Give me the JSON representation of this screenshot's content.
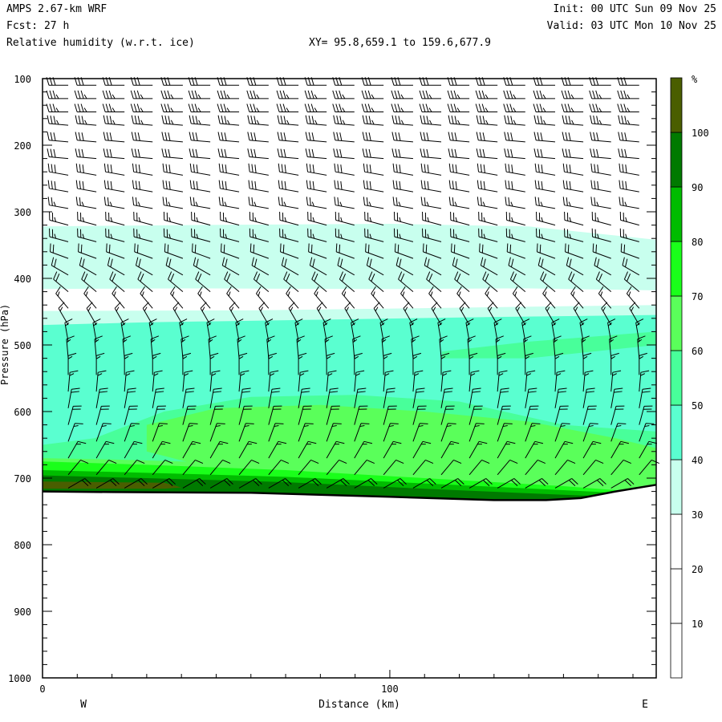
{
  "header": {
    "model": "AMPS 2.67-km WRF",
    "forecast": "Fcst:   27 h",
    "field": "Relative humidity (w.r.t. ice)",
    "xy": "XY=  95.8,659.1 to 159.6,677.9",
    "init": "Init: 00 UTC Sun 09 Nov 25",
    "valid": "Valid: 03 UTC Mon 10 Nov 25"
  },
  "chart_data": {
    "type": "heatmap",
    "title": "Relative humidity (w.r.t. ice)",
    "xlabel": "Distance (km)",
    "ylabel": "Pressure (hPa)",
    "xlim": [
      0,
      176.7
    ],
    "ylim": [
      1000,
      100
    ],
    "x_ticks": [
      "0",
      "100"
    ],
    "y_ticks": [
      "100",
      "200",
      "300",
      "400",
      "500",
      "600",
      "700",
      "800",
      "900",
      "1000"
    ],
    "left_label": "W",
    "right_label": "E",
    "colorbar": {
      "unit": "%",
      "labels": [
        "10",
        "20",
        "30",
        "40",
        "50",
        "60",
        "70",
        "80",
        "90",
        "100"
      ],
      "levels": [
        0,
        10,
        20,
        30,
        40,
        50,
        60,
        70,
        80,
        90,
        100,
        110
      ],
      "colors": [
        "#ffffff",
        "#ffffff",
        "#ffffff",
        "#c8ffee",
        "#5affd0",
        "#48ff9a",
        "#5aff5a",
        "#1aff1a",
        "#00bc00",
        "#007a00",
        "#4a5e00"
      ]
    },
    "terrain_surface": {
      "distance_km": [
        0,
        20,
        60,
        100,
        130,
        145,
        155,
        165,
        176.7
      ],
      "pressure_hPa": [
        720,
        721,
        722,
        728,
        733,
        733,
        730,
        720,
        710
      ]
    },
    "rh_regions": [
      {
        "min": 30,
        "distance_km": [
          0,
          40,
          100,
          140,
          176.7,
          176.7,
          140,
          100,
          40,
          0
        ],
        "pressure_hPa": [
          322,
          320,
          318,
          322,
          342,
          418,
          415,
          416,
          415,
          416
        ]
      },
      {
        "min": 30,
        "distance_km": [
          0,
          60,
          120,
          176.7,
          176.7,
          0
        ],
        "pressure_hPa": [
          449,
          448,
          444,
          440,
          720,
          720
        ]
      },
      {
        "min": 40,
        "distance_km": [
          0,
          30,
          80,
          130,
          176.7,
          176.7,
          0
        ],
        "pressure_hPa": [
          470,
          466,
          462,
          458,
          455,
          720,
          720
        ]
      },
      {
        "min": 50,
        "distance_km": [
          0,
          15,
          35,
          60,
          90,
          120,
          150,
          176.7,
          176.7,
          150,
          120,
          90,
          60,
          30,
          0
        ],
        "pressure_hPa": [
          650,
          640,
          600,
          578,
          575,
          585,
          620,
          630,
          700,
          705,
          710,
          712,
          700,
          690,
          690
        ]
      },
      {
        "min": 50,
        "distance_km": [
          115,
          140,
          176.7,
          176.7,
          140,
          115
        ],
        "pressure_hPa": [
          510,
          495,
          480,
          500,
          520,
          520
        ]
      },
      {
        "min": 60,
        "distance_km": [
          30,
          50,
          80,
          110,
          140,
          165,
          176.7,
          176.7,
          140,
          100,
          60,
          30
        ],
        "pressure_hPa": [
          620,
          595,
          590,
          600,
          615,
          640,
          655,
          705,
          712,
          715,
          700,
          660
        ]
      },
      {
        "min": 60,
        "distance_km": [
          0,
          20,
          60,
          100,
          176.7,
          176.7,
          0
        ],
        "pressure_hPa": [
          670,
          672,
          678,
          690,
          695,
          720,
          720
        ]
      },
      {
        "min": 70,
        "distance_km": [
          0,
          30,
          70,
          110,
          150,
          165,
          165,
          0
        ],
        "pressure_hPa": [
          675,
          680,
          688,
          700,
          712,
          718,
          735,
          735
        ]
      },
      {
        "min": 80,
        "distance_km": [
          0,
          30,
          70,
          110,
          150,
          165,
          165,
          0
        ],
        "pressure_hPa": [
          688,
          692,
          698,
          708,
          718,
          722,
          735,
          735
        ]
      },
      {
        "min": 90,
        "distance_km": [
          0,
          30,
          70,
          110,
          150,
          165,
          165,
          0
        ],
        "pressure_hPa": [
          696,
          700,
          706,
          716,
          725,
          728,
          735,
          735
        ]
      },
      {
        "min": 100,
        "distance_km": [
          0,
          35,
          40,
          35,
          0
        ],
        "pressure_hPa": [
          705,
          707,
          714,
          716,
          716
        ]
      }
    ],
    "wind_barbs": {
      "columns_km": [
        7.4,
        15.5,
        23.6,
        31.7,
        40.4,
        48.3,
        56.6,
        65.1,
        73.7,
        81.8,
        89.8,
        98.2,
        106.7,
        114.8,
        122.9,
        131.0,
        139.0,
        147.6,
        155.7,
        163.7,
        171.8
      ],
      "levels_hPa": [
        110,
        130,
        150,
        170,
        195,
        220,
        245,
        270,
        295,
        320,
        345,
        370,
        395,
        420,
        445,
        470,
        495,
        520,
        545,
        570,
        595,
        620,
        645,
        670,
        695,
        715
      ],
      "direction_deg": [
        270,
        270,
        270,
        275,
        275,
        275,
        280,
        280,
        280,
        285,
        285,
        290,
        300,
        310,
        320,
        330,
        350,
        355,
        0,
        5,
        10,
        15,
        20,
        30,
        40,
        60
      ],
      "speed_kt": [
        30,
        35,
        35,
        35,
        30,
        30,
        30,
        30,
        25,
        25,
        25,
        20,
        20,
        20,
        15,
        15,
        15,
        15,
        15,
        15,
        20,
        20,
        15,
        15,
        10,
        20
      ]
    }
  }
}
